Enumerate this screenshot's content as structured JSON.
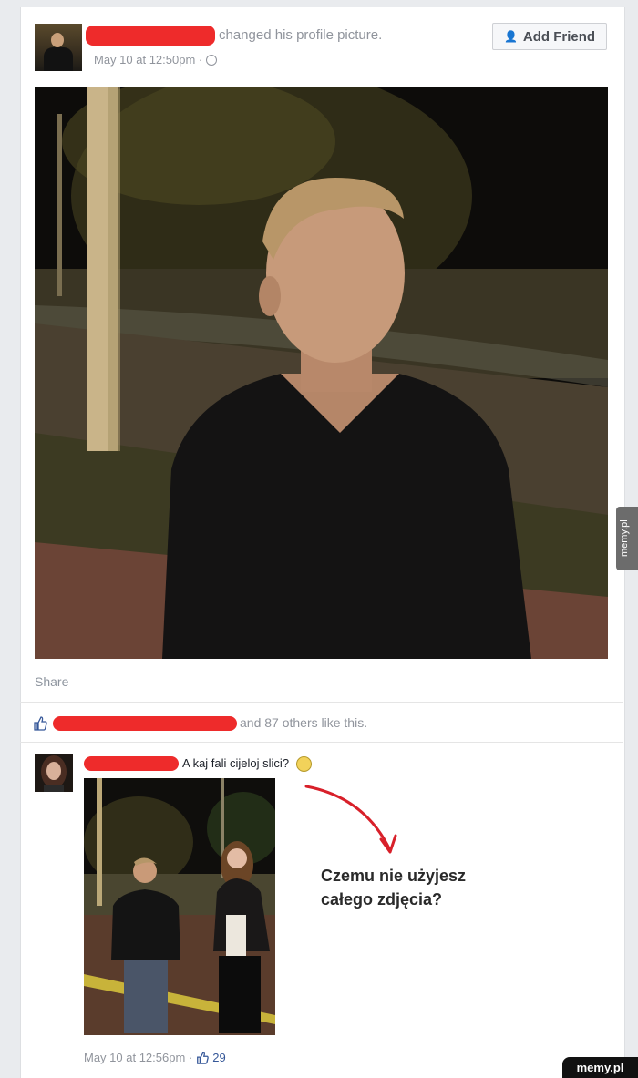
{
  "post": {
    "action_text": "changed his profile picture.",
    "timestamp": "May 10 at 12:50pm · ",
    "add_friend_label": "Add Friend",
    "share_label": "Share",
    "likes_text": "and 87 others like this."
  },
  "comment": {
    "text": "A kaj fali cijeloj slici?",
    "timestamp": "May 10 at 12:56pm · ",
    "like_count": "29"
  },
  "annotation": {
    "line1": "Czemu nie użyjesz",
    "line2": "całego zdjęcia?"
  },
  "watermarks": {
    "side": "memy.pl",
    "bottom": "memy.pl"
  },
  "colors": {
    "link": "#365899",
    "meta": "#90949c",
    "redaction": "#ee2b2b",
    "arrow": "#d8202a"
  }
}
